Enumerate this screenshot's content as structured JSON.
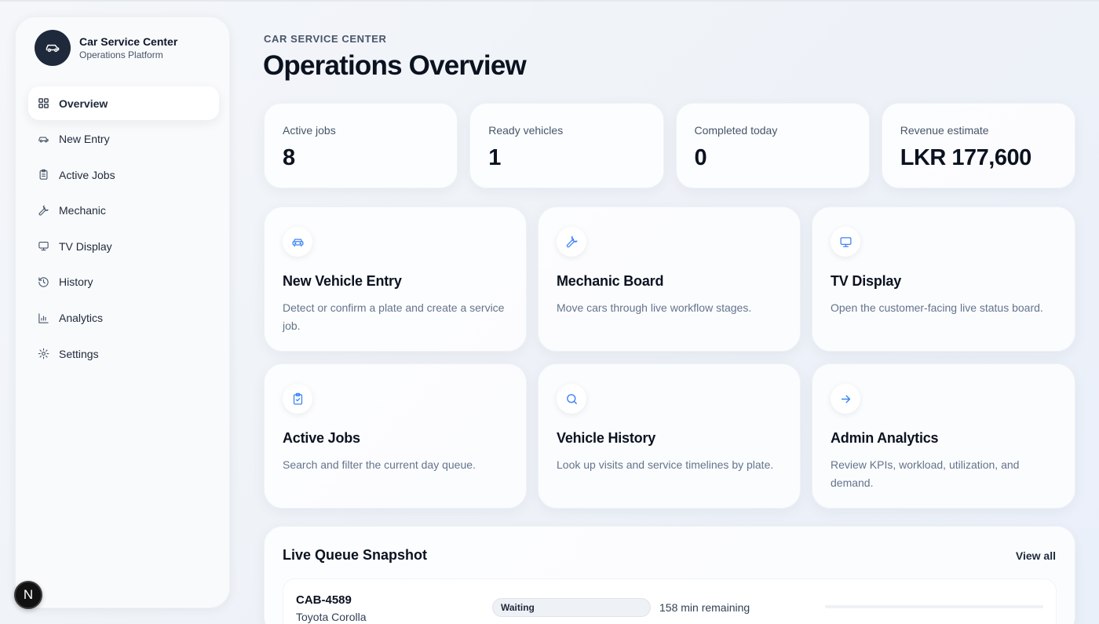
{
  "brand": {
    "title": "Car Service Center",
    "subtitle": "Operations Platform",
    "icon": "car-icon"
  },
  "sidebar": {
    "items": [
      {
        "label": "Overview",
        "icon": "grid-icon",
        "active": true
      },
      {
        "label": "New Entry",
        "icon": "car-icon"
      },
      {
        "label": "Active Jobs",
        "icon": "clipboard-icon"
      },
      {
        "label": "Mechanic",
        "icon": "wrench-icon"
      },
      {
        "label": "TV Display",
        "icon": "monitor-icon"
      },
      {
        "label": "History",
        "icon": "history-icon"
      },
      {
        "label": "Analytics",
        "icon": "bar-chart-icon"
      },
      {
        "label": "Settings",
        "icon": "gear-icon"
      }
    ]
  },
  "header": {
    "eyebrow": "CAR SERVICE CENTER",
    "title": "Operations Overview"
  },
  "stats": [
    {
      "label": "Active jobs",
      "value": "8"
    },
    {
      "label": "Ready vehicles",
      "value": "1"
    },
    {
      "label": "Completed today",
      "value": "0"
    },
    {
      "label": "Revenue estimate",
      "value": "LKR 177,600"
    }
  ],
  "cards": [
    {
      "title": "New Vehicle Entry",
      "description": "Detect or confirm a plate and create a service job.",
      "icon": "car-icon"
    },
    {
      "title": "Mechanic Board",
      "description": "Move cars through live workflow stages.",
      "icon": "wrench-icon"
    },
    {
      "title": "TV Display",
      "description": "Open the customer-facing live status board.",
      "icon": "monitor-icon"
    },
    {
      "title": "Active Jobs",
      "description": "Search and filter the current day queue.",
      "icon": "clipboard-check-icon"
    },
    {
      "title": "Vehicle History",
      "description": "Look up visits and service timelines by plate.",
      "icon": "search-icon"
    },
    {
      "title": "Admin Analytics",
      "description": "Review KPIs, workload, utilization, and demand.",
      "icon": "arrow-right-icon"
    }
  ],
  "queue": {
    "title": "Live Queue Snapshot",
    "view_all": "View all",
    "rows": [
      {
        "plate": "CAB-4589",
        "model": "Toyota Corolla",
        "status": "Waiting",
        "remaining": "158 min remaining",
        "progress": 0
      }
    ]
  },
  "dev_badge": "N",
  "colors": {
    "accent": "#3b82f6",
    "dark": "#1e293b",
    "background": "#f4f6f9"
  }
}
